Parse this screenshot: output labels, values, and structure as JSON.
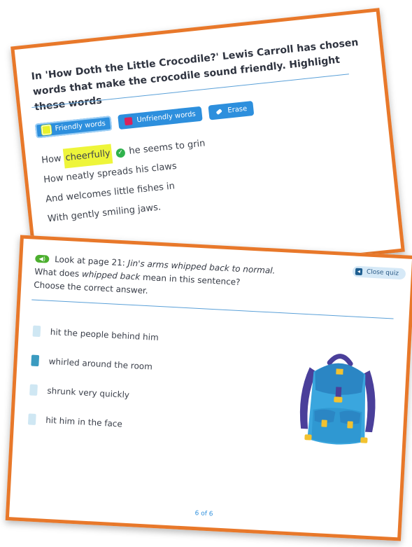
{
  "top_card": {
    "question": "In 'How Doth the Little Crocodile?' Lewis Carroll has chosen words that make the crocodile sound friendly. Highlight these words",
    "tools": {
      "friendly": "Friendly words",
      "unfriendly": "Unfriendly words",
      "erase": "Erase"
    },
    "poem": {
      "line1_before": "How",
      "line1_highlight": "cheerfully",
      "line1_after": "he seems to grin",
      "line2": "How neatly spreads his claws",
      "line3": "And welcomes little fishes in",
      "line4": "With gently smiling jaws."
    }
  },
  "bottom_card": {
    "prompt_prefix": "Look at page 21:",
    "prompt_quote": "Jin's arms whipped back to normal.",
    "question_pre": "What does",
    "question_em": "whipped back",
    "question_post": "mean in this sentence?",
    "instruction": "Choose the correct answer.",
    "close_label": "Close quiz",
    "options": [
      {
        "label": "hit the people behind him",
        "selected": false
      },
      {
        "label": "whirled around the room",
        "selected": true
      },
      {
        "label": "shrunk very quickly",
        "selected": false
      },
      {
        "label": "hit him in the face",
        "selected": false
      }
    ],
    "pager": "6 of 6"
  },
  "colors": {
    "card_border": "#e8782a",
    "button_blue": "#2d8fdd",
    "highlight_yellow": "#eef53a",
    "unfriendly_red": "#d8225c",
    "correct_green": "#2fb24c",
    "speaker_green": "#4caf2e"
  },
  "icons": {
    "speaker": "speaker-icon",
    "tick": "check-circle-icon",
    "erase": "eraser-icon",
    "close": "close-quiz-icon",
    "backpack": "backpack-illustration"
  }
}
